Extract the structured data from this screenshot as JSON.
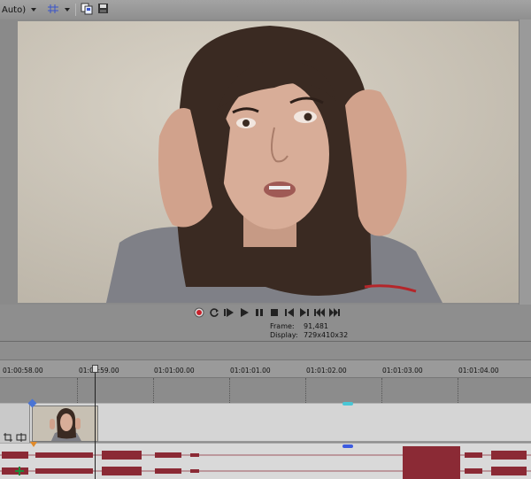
{
  "toolbar": {
    "quality_label": "Auto)",
    "icons": [
      "grid-icon",
      "copy-frame-icon",
      "save-snapshot-icon"
    ]
  },
  "preview": {
    "frame_label": "Frame:",
    "frame_value": "91,481",
    "display_label": "Display:",
    "display_value": "729x410x32"
  },
  "transport": {
    "buttons": [
      "record-icon",
      "loop-icon",
      "play-from-start-icon",
      "play-icon",
      "pause-icon",
      "stop-icon",
      "prev-frame-icon",
      "next-frame-icon",
      "go-start-icon",
      "go-end-icon"
    ]
  },
  "timeline": {
    "ticks": [
      "01:00:58.00",
      "01:00:59.00",
      "01:01:00.00",
      "01:01:01.00",
      "01:01:02.00",
      "01:01:03.00",
      "01:01:04.00"
    ]
  },
  "colors": {
    "waveform": "#8b2a35",
    "record": "#c8202a",
    "marker_cyan": "#49c7d6",
    "marker_blue": "#3c5be0"
  }
}
